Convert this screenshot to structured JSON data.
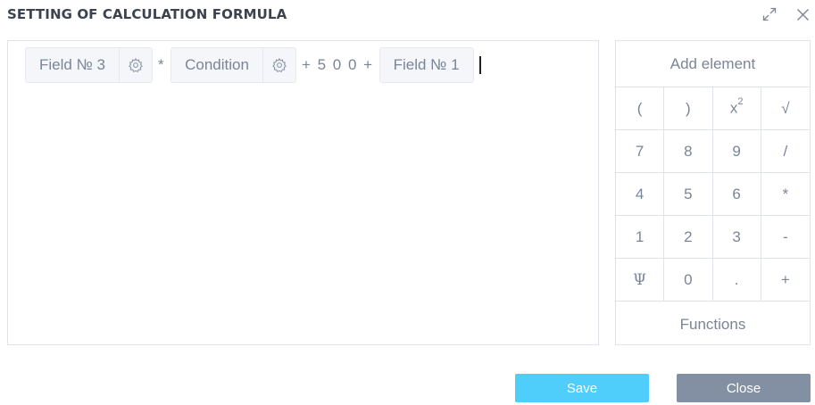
{
  "dialog": {
    "title": "SETTING OF CALCULATION FORMULA",
    "expand_icon": "expand-icon",
    "close_icon": "close-icon"
  },
  "formula": {
    "tokens": [
      {
        "type": "field",
        "label": "Field № 3",
        "icon": "gear-icon"
      },
      {
        "type": "operator",
        "text": "*"
      },
      {
        "type": "field",
        "label": "Condition",
        "icon": "gear-icon"
      },
      {
        "type": "operator",
        "text": "+ 5 0 0 +"
      },
      {
        "type": "field",
        "label": "Field № 1"
      }
    ]
  },
  "keypad": {
    "header": "Add element",
    "keys": [
      "(",
      ")",
      "x²",
      "√",
      "7",
      "8",
      "9",
      "/",
      "4",
      "5",
      "6",
      "*",
      "1",
      "2",
      "3",
      "-",
      "Ψ",
      "0",
      ".",
      "+"
    ],
    "footer": "Functions"
  },
  "buttons": {
    "save": "Save",
    "close": "Close"
  },
  "colors": {
    "save": "#4fcdfb",
    "close": "#8390a3",
    "title": "#3d434d",
    "text": "#7a8597"
  }
}
